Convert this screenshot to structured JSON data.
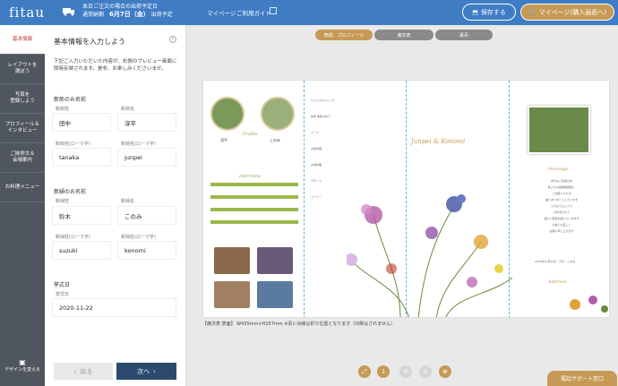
{
  "header": {
    "logo": "fitau",
    "shipping_line1": "本日ご注文の場合の出荷予定日",
    "shipping_line2_prefix": "通常納期",
    "shipping_date": "6月7日（金）",
    "shipping_line2_suffix": "出荷予定",
    "nav_mypage": "マイページ",
    "nav_guide": "ご利用ガイド",
    "save_label": "保存する",
    "mypage_button": "マイページ(購入画面へ)"
  },
  "sidebar": {
    "items": [
      {
        "label": "基本情報"
      },
      {
        "label": "レイアウトを\n選ぼう"
      },
      {
        "label": "写真を\n登録しよう"
      },
      {
        "label": "プロフィール＆\nインタビュー"
      },
      {
        "label": "ご挨拶文＆\n会場案内"
      },
      {
        "label": "お料理メニュー"
      }
    ],
    "design_label": "デザインを変える"
  },
  "panel": {
    "title": "基本情報を入力しよう",
    "help": "?",
    "description": "下記ご入力いただいた内容が、右側のプレビュー画面に即時反映されます。是非、お楽しみくださいませ。",
    "groom_section": "新郎のお名前",
    "bride_section": "新婦のお名前",
    "wedding_section": "挙式日",
    "groom": {
      "last_label": "新郎姓",
      "first_label": "新郎名",
      "last": "田中",
      "first": "淳平",
      "last_roma_label": "新郎姓(ローマ字)",
      "first_roma_label": "新郎名(ローマ字)",
      "last_roma": "tanaka",
      "first_roma": "junpei"
    },
    "bride": {
      "last_label": "新婦姓",
      "first_label": "新婦名",
      "last": "鈴木",
      "first": "このみ",
      "last_roma_label": "新婦姓(ローマ字)",
      "first_roma_label": "新婦名(ローマ字)",
      "last_roma": "suzuki",
      "first_roma": "konomi"
    },
    "wedding": {
      "label": "挙式日",
      "date": "2020-11-22"
    },
    "back_label": "戻る",
    "next_label": "次へ"
  },
  "tabs": [
    "表紙、プロフィール",
    "席次表",
    "裏吊"
  ],
  "preview": {
    "caption": "【席次表 表面】 W435mm×H257mm ※青い点線は折り位置となります（印刷はされません）",
    "couple_script": "Junpei & Konomi",
    "groom_name": "淳平",
    "bride_name": "このみ",
    "profile_heading": "Profile",
    "interview_heading": "Interview",
    "message_heading": "Message",
    "address_heading": "Address",
    "date_sign": "2020年11月22日　淳平・このみ",
    "menu_items": [
      "ウェルカムドリンク",
      "前菜 季節の彩り",
      "スープ",
      "お魚料理",
      "お肉料理",
      "デザート",
      "コーヒー"
    ],
    "message_lines": [
      "本日はご多用の中",
      "私たちの結婚披露宴に",
      "ご出席いただき",
      "誠にありがとうございます",
      "これからも二人で",
      "力を合わせて",
      "温かい家庭を築いていきます",
      "今後とも宜しく",
      "お願い申し上げます"
    ]
  },
  "controls": {
    "support_label": "電話サポート窓口"
  },
  "colors": {
    "header": "#3f7cc4",
    "accent_gold": "#c69a55",
    "sidebar": "#4f565d",
    "next_button": "#2b4a6e",
    "fold_line": "#5ab4e5"
  }
}
